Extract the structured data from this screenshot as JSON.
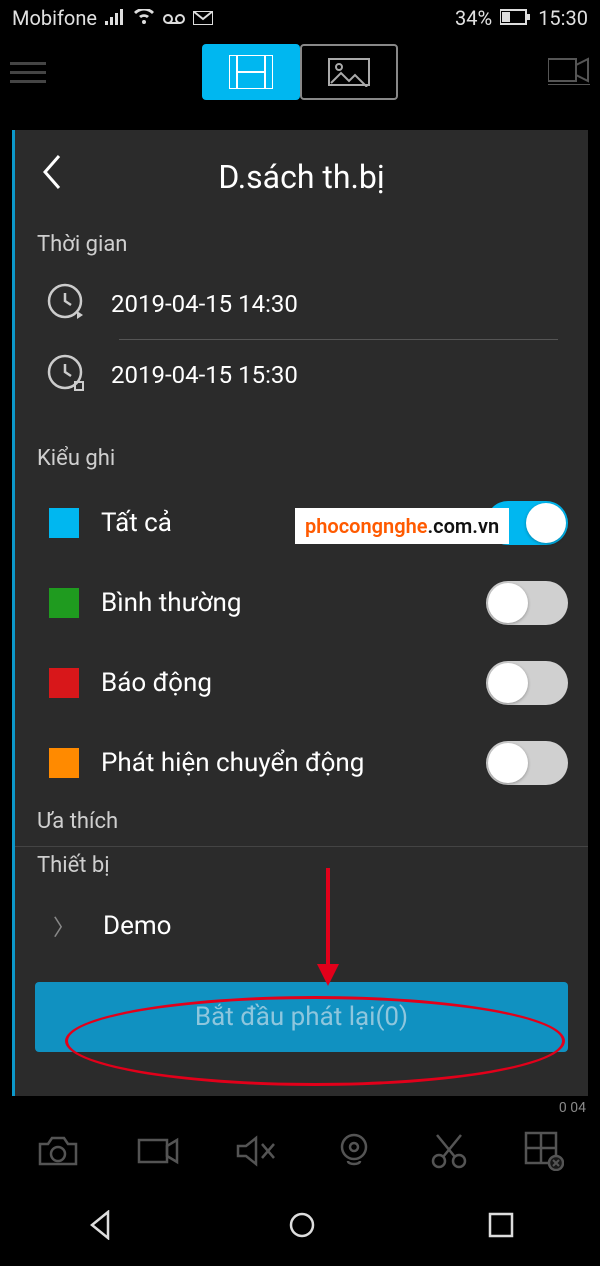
{
  "status_bar": {
    "carrier": "Mobifone",
    "battery_pct": "34%",
    "time": "15:30"
  },
  "panel": {
    "title": "D.sách th.bị"
  },
  "time_section": {
    "label": "Thời gian",
    "start": "2019-04-15 14:30",
    "end": "2019-04-15 15:30"
  },
  "record_type_section": {
    "label": "Kiểu ghi",
    "items": [
      {
        "color": "#00b7f0",
        "label": "Tất cả",
        "on": true
      },
      {
        "color": "#1f9b1f",
        "label": "Bình thường",
        "on": false
      },
      {
        "color": "#d8171a",
        "label": "Báo động",
        "on": false
      },
      {
        "color": "#ff8a00",
        "label": "Phát hiện chuyển động",
        "on": false
      }
    ]
  },
  "favorites_label": "Ưa thích",
  "device_section": {
    "label": "Thiết bị",
    "item": "Demo"
  },
  "start_button": "Bắt đầu phát lại(0)",
  "watermark_prefix": "phocongnghe",
  "watermark_suffix": ".com.vn",
  "mini_timestamp": "0 04"
}
